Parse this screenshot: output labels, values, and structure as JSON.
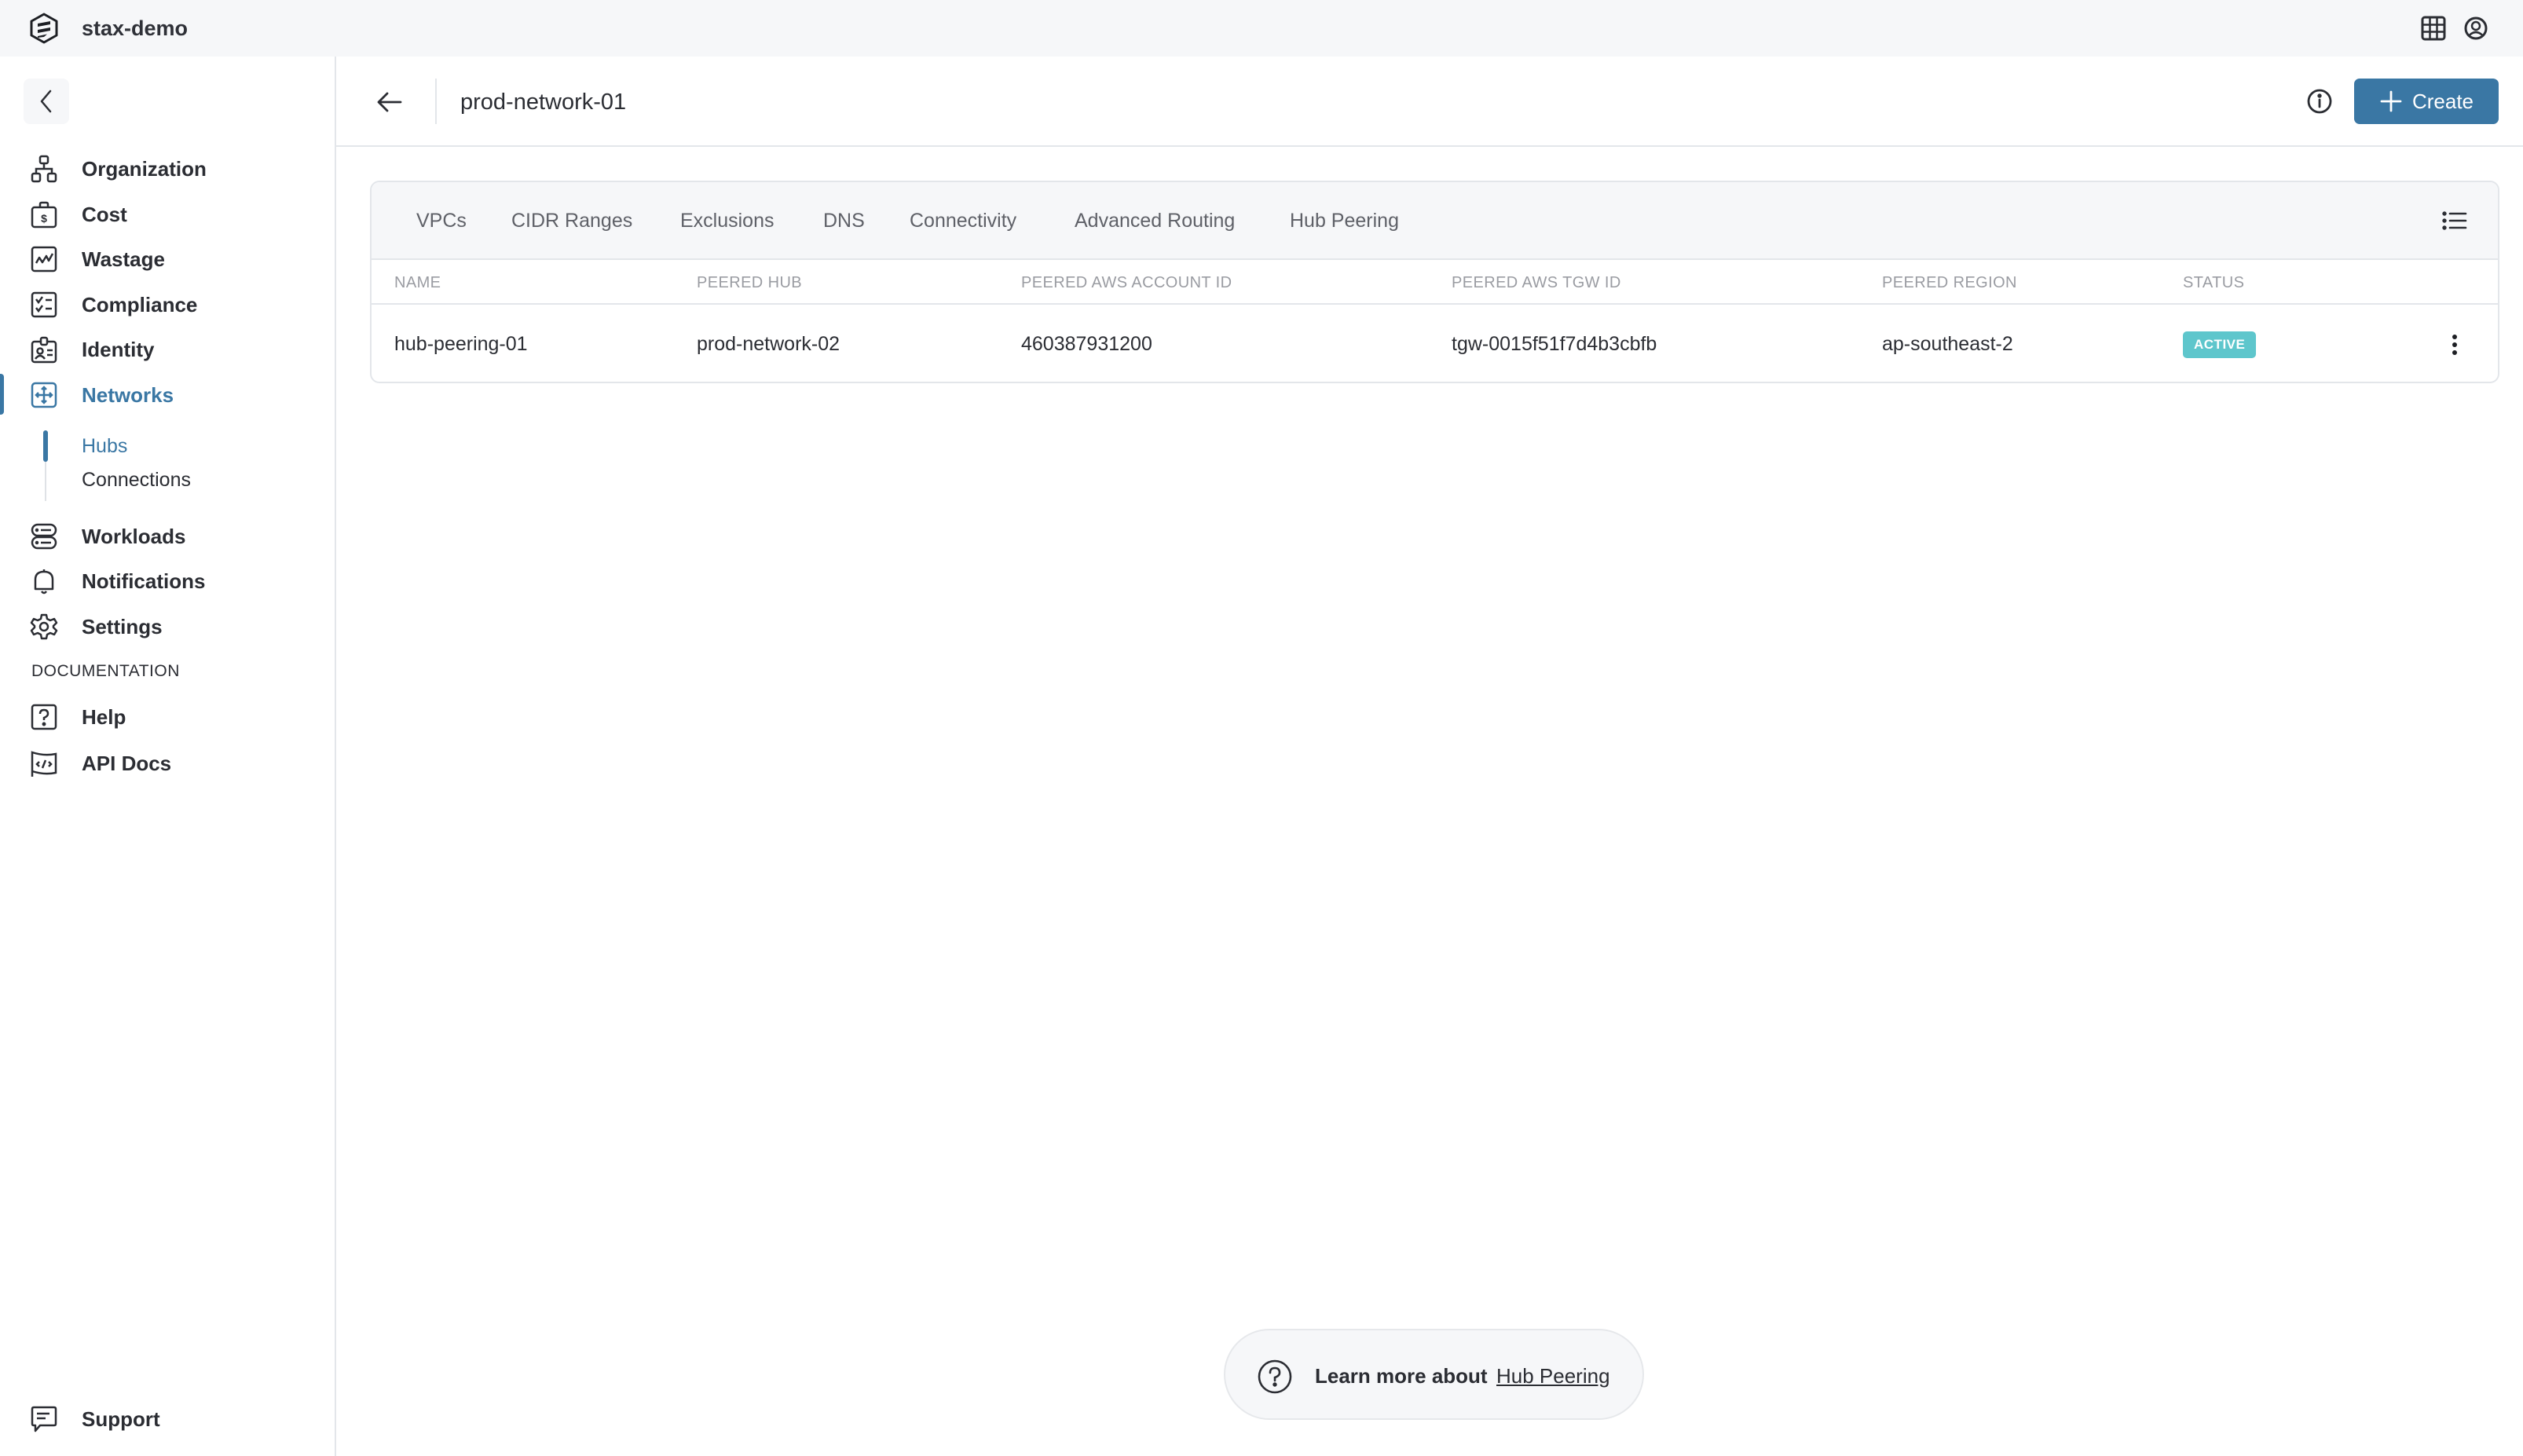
{
  "app": {
    "org_name": "stax-demo",
    "logo_icon": "stax-hexagon-logo",
    "top_icons": [
      "apps-grid-icon",
      "user-account-icon"
    ]
  },
  "sidebar": {
    "collapse_icon": "chevron-left-icon",
    "items": [
      {
        "label": "Organization",
        "icon": "org-chart-icon"
      },
      {
        "label": "Cost",
        "icon": "money-bag-icon"
      },
      {
        "label": "Wastage",
        "icon": "chart-line-icon"
      },
      {
        "label": "Compliance",
        "icon": "checklist-icon"
      },
      {
        "label": "Identity",
        "icon": "id-badge-icon"
      },
      {
        "label": "Networks",
        "icon": "move-arrows-icon",
        "active": true
      },
      {
        "label": "Workloads",
        "icon": "server-stack-icon"
      },
      {
        "label": "Notifications",
        "icon": "bell-icon"
      },
      {
        "label": "Settings",
        "icon": "gear-icon"
      }
    ],
    "networks_sub": [
      {
        "label": "Hubs",
        "active": true
      },
      {
        "label": "Connections",
        "active": false
      }
    ],
    "documentation_label": "DOCUMENTATION",
    "doc_items": [
      {
        "label": "Help",
        "icon": "help-square-icon"
      },
      {
        "label": "API Docs",
        "icon": "code-flag-icon"
      }
    ],
    "support": {
      "label": "Support",
      "icon": "chat-bubble-icon"
    }
  },
  "header": {
    "title": "prod-network-01",
    "back_icon": "arrow-left-icon",
    "info_icon": "info-circle-icon",
    "create_label": "Create"
  },
  "tabs": [
    {
      "label": "VPCs"
    },
    {
      "label": "CIDR Ranges"
    },
    {
      "label": "Exclusions"
    },
    {
      "label": "DNS"
    },
    {
      "label": "Connectivity"
    },
    {
      "label": "Advanced Routing"
    },
    {
      "label": "Hub Peering"
    }
  ],
  "table": {
    "columns": [
      "NAME",
      "PEERED HUB",
      "PEERED AWS ACCOUNT ID",
      "PEERED AWS TGW ID",
      "PEERED REGION",
      "STATUS"
    ],
    "rows": [
      {
        "name": "hub-peering-01",
        "peered_hub": "prod-network-02",
        "peered_aws_account_id": "460387931200",
        "peered_aws_tgw_id": "tgw-0015f51f7d4b3cbfb",
        "peered_region": "ap-southeast-2",
        "status": "ACTIVE"
      }
    ]
  },
  "help_banner": {
    "lead": "Learn more about",
    "link": "Hub Peering"
  },
  "colors": {
    "accent": "#3a77a4",
    "status_active": "#5ec6cc",
    "topbar_bg": "#f6f7f9",
    "text": "#2b2d33"
  }
}
